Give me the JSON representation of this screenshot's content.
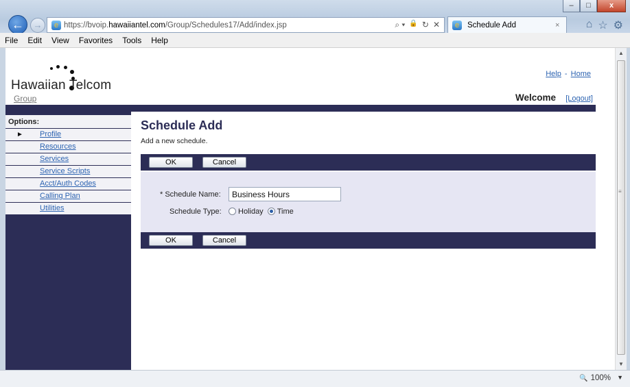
{
  "browser": {
    "address_url": "https://bvoip.hawaiiantel.com/Group/Schedules17/Add/index.jsp",
    "url_prefix": "https://bvoip.",
    "url_domain": "hawaiiantel.com",
    "url_path": "/Group/Schedules17/Add/index.jsp",
    "tab_title": "Schedule Add",
    "tab_close": "×",
    "search_glyph": "⌕ ▾",
    "lock_glyph": "🔒",
    "refresh_glyph": "↻",
    "stop_glyph": "✕",
    "back_glyph": "←",
    "forward_glyph": "→",
    "home_glyph": "⌂",
    "favorites_glyph": "☆",
    "settings_glyph": "⚙",
    "window_minimize": "–",
    "window_maximize": "□",
    "window_close": "x",
    "zoom": "100%",
    "zoom_icon": "🔍",
    "zoom_caret": "▼",
    "menu": [
      "File",
      "Edit",
      "View",
      "Favorites",
      "Tools",
      "Help"
    ]
  },
  "header": {
    "logo_text": "Hawaiian Telcom",
    "help_link": "Help",
    "link_separator": "-",
    "home_link": "Home",
    "group_link": "Group",
    "welcome": "Welcome",
    "logout": "[Logout]"
  },
  "sidebar": {
    "title": "Options:",
    "active_marker": "►",
    "items": [
      {
        "label": "Profile"
      },
      {
        "label": "Resources"
      },
      {
        "label": "Services"
      },
      {
        "label": "Service Scripts"
      },
      {
        "label": "Acct/Auth Codes"
      },
      {
        "label": "Calling Plan"
      },
      {
        "label": "Utilities"
      }
    ]
  },
  "main": {
    "title": "Schedule Add",
    "description": "Add a new schedule.",
    "ok_label": "OK",
    "cancel_label": "Cancel",
    "schedule_name_label": "* Schedule Name:",
    "schedule_name_value": "Business Hours",
    "schedule_type_label": "Schedule Type:",
    "schedule_type_options": [
      {
        "label": "Holiday",
        "selected": false
      },
      {
        "label": "Time",
        "selected": true
      }
    ]
  },
  "colors": {
    "navy": "#2c2d56",
    "link": "#2c63b1",
    "form_panel": "#e6e6f3"
  }
}
